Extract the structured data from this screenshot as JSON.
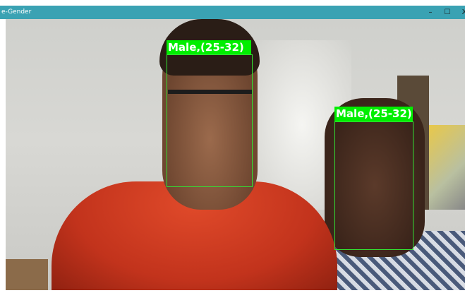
{
  "window": {
    "title": "e-Gender",
    "controls": {
      "minimize": "–",
      "maximize": "☐",
      "close": "X"
    }
  },
  "detections": [
    {
      "label": "Male,(25-32)"
    },
    {
      "label": "Male,(25-32)"
    }
  ],
  "colors": {
    "titlebar": "#3aa2b3",
    "box": "#33e033",
    "label_bg": "#00ee00"
  }
}
